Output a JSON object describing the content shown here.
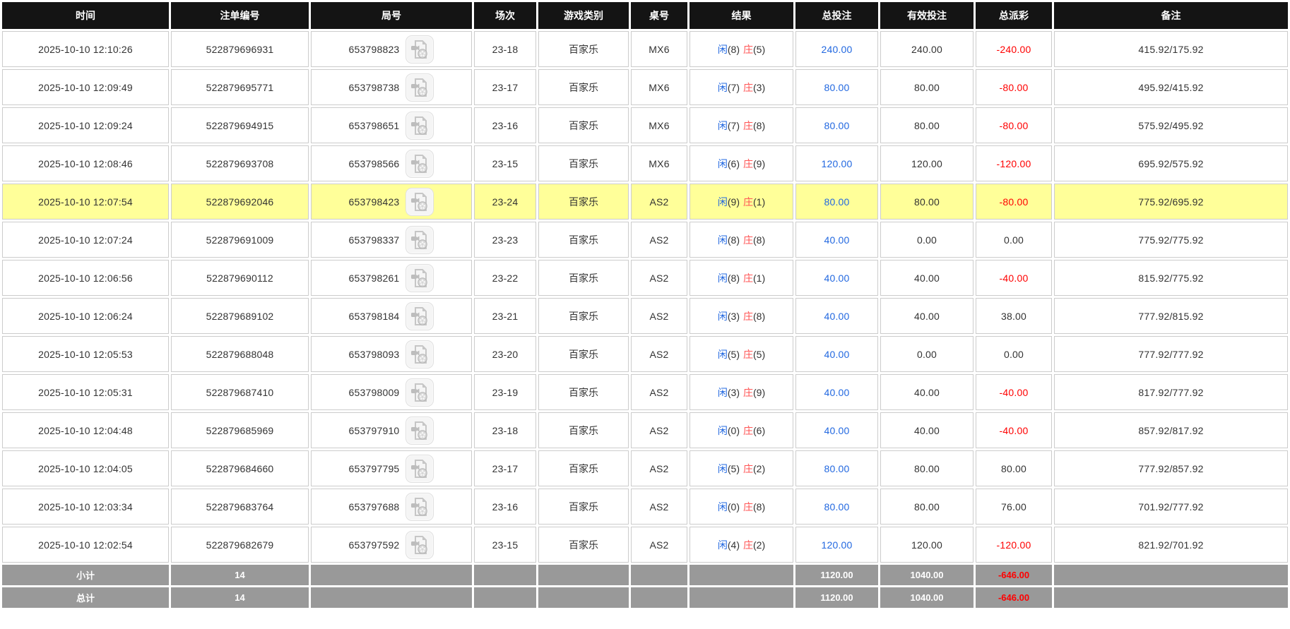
{
  "colors": {
    "header_bg": "#141414",
    "header_text": "#FFFFFF",
    "row_highlight": "#FFFF99",
    "footer_bg": "#999999",
    "footer_text": "#FFFFFF",
    "bet_blue": "#2268E0",
    "loss_red": "#FF0000",
    "banker_red": "#FF5454",
    "cell_border": "#CCCCCC",
    "body_text": "#333333"
  },
  "icons": {
    "video_button": "video-record-icon"
  },
  "table": {
    "headers": [
      "时间",
      "注单编号",
      "局号",
      "场次",
      "游戏类别",
      "桌号",
      "结果",
      "总投注",
      "有效投注",
      "总派彩",
      "备注"
    ],
    "rows": [
      {
        "time": "2025-10-10 12:10:26",
        "bet_id": "522879696931",
        "round_id": "653798823",
        "session": "23-18",
        "game": "百家乐",
        "table_id": "MX6",
        "result_player": "闲",
        "result_player_score": "(8)",
        "result_banker": "庄",
        "result_banker_score": "(5)",
        "total_bet": "240.00",
        "valid_bet": "240.00",
        "payout": "-240.00",
        "remark": "415.92/175.92",
        "highlighted": false
      },
      {
        "time": "2025-10-10 12:09:49",
        "bet_id": "522879695771",
        "round_id": "653798738",
        "session": "23-17",
        "game": "百家乐",
        "table_id": "MX6",
        "result_player": "闲",
        "result_player_score": "(7)",
        "result_banker": "庄",
        "result_banker_score": "(3)",
        "total_bet": "80.00",
        "valid_bet": "80.00",
        "payout": "-80.00",
        "remark": "495.92/415.92",
        "highlighted": false
      },
      {
        "time": "2025-10-10 12:09:24",
        "bet_id": "522879694915",
        "round_id": "653798651",
        "session": "23-16",
        "game": "百家乐",
        "table_id": "MX6",
        "result_player": "闲",
        "result_player_score": "(7)",
        "result_banker": "庄",
        "result_banker_score": "(8)",
        "total_bet": "80.00",
        "valid_bet": "80.00",
        "payout": "-80.00",
        "remark": "575.92/495.92",
        "highlighted": false
      },
      {
        "time": "2025-10-10 12:08:46",
        "bet_id": "522879693708",
        "round_id": "653798566",
        "session": "23-15",
        "game": "百家乐",
        "table_id": "MX6",
        "result_player": "闲",
        "result_player_score": "(6)",
        "result_banker": "庄",
        "result_banker_score": "(9)",
        "total_bet": "120.00",
        "valid_bet": "120.00",
        "payout": "-120.00",
        "remark": "695.92/575.92",
        "highlighted": false
      },
      {
        "time": "2025-10-10 12:07:54",
        "bet_id": "522879692046",
        "round_id": "653798423",
        "session": "23-24",
        "game": "百家乐",
        "table_id": "AS2",
        "result_player": "闲",
        "result_player_score": "(9)",
        "result_banker": "庄",
        "result_banker_score": "(1)",
        "total_bet": "80.00",
        "valid_bet": "80.00",
        "payout": "-80.00",
        "remark": "775.92/695.92",
        "highlighted": true
      },
      {
        "time": "2025-10-10 12:07:24",
        "bet_id": "522879691009",
        "round_id": "653798337",
        "session": "23-23",
        "game": "百家乐",
        "table_id": "AS2",
        "result_player": "闲",
        "result_player_score": "(8)",
        "result_banker": "庄",
        "result_banker_score": "(8)",
        "total_bet": "40.00",
        "valid_bet": "0.00",
        "payout": "0.00",
        "remark": "775.92/775.92",
        "highlighted": false
      },
      {
        "time": "2025-10-10 12:06:56",
        "bet_id": "522879690112",
        "round_id": "653798261",
        "session": "23-22",
        "game": "百家乐",
        "table_id": "AS2",
        "result_player": "闲",
        "result_player_score": "(8)",
        "result_banker": "庄",
        "result_banker_score": "(1)",
        "total_bet": "40.00",
        "valid_bet": "40.00",
        "payout": "-40.00",
        "remark": "815.92/775.92",
        "highlighted": false
      },
      {
        "time": "2025-10-10 12:06:24",
        "bet_id": "522879689102",
        "round_id": "653798184",
        "session": "23-21",
        "game": "百家乐",
        "table_id": "AS2",
        "result_player": "闲",
        "result_player_score": "(3)",
        "result_banker": "庄",
        "result_banker_score": "(8)",
        "total_bet": "40.00",
        "valid_bet": "40.00",
        "payout": "38.00",
        "remark": "777.92/815.92",
        "highlighted": false
      },
      {
        "time": "2025-10-10 12:05:53",
        "bet_id": "522879688048",
        "round_id": "653798093",
        "session": "23-20",
        "game": "百家乐",
        "table_id": "AS2",
        "result_player": "闲",
        "result_player_score": "(5)",
        "result_banker": "庄",
        "result_banker_score": "(5)",
        "total_bet": "40.00",
        "valid_bet": "0.00",
        "payout": "0.00",
        "remark": "777.92/777.92",
        "highlighted": false
      },
      {
        "time": "2025-10-10 12:05:31",
        "bet_id": "522879687410",
        "round_id": "653798009",
        "session": "23-19",
        "game": "百家乐",
        "table_id": "AS2",
        "result_player": "闲",
        "result_player_score": "(3)",
        "result_banker": "庄",
        "result_banker_score": "(9)",
        "total_bet": "40.00",
        "valid_bet": "40.00",
        "payout": "-40.00",
        "remark": "817.92/777.92",
        "highlighted": false
      },
      {
        "time": "2025-10-10 12:04:48",
        "bet_id": "522879685969",
        "round_id": "653797910",
        "session": "23-18",
        "game": "百家乐",
        "table_id": "AS2",
        "result_player": "闲",
        "result_player_score": "(0)",
        "result_banker": "庄",
        "result_banker_score": "(6)",
        "total_bet": "40.00",
        "valid_bet": "40.00",
        "payout": "-40.00",
        "remark": "857.92/817.92",
        "highlighted": false
      },
      {
        "time": "2025-10-10 12:04:05",
        "bet_id": "522879684660",
        "round_id": "653797795",
        "session": "23-17",
        "game": "百家乐",
        "table_id": "AS2",
        "result_player": "闲",
        "result_player_score": "(5)",
        "result_banker": "庄",
        "result_banker_score": "(2)",
        "total_bet": "80.00",
        "valid_bet": "80.00",
        "payout": "80.00",
        "remark": "777.92/857.92",
        "highlighted": false
      },
      {
        "time": "2025-10-10 12:03:34",
        "bet_id": "522879683764",
        "round_id": "653797688",
        "session": "23-16",
        "game": "百家乐",
        "table_id": "AS2",
        "result_player": "闲",
        "result_player_score": "(0)",
        "result_banker": "庄",
        "result_banker_score": "(8)",
        "total_bet": "80.00",
        "valid_bet": "80.00",
        "payout": "76.00",
        "remark": "701.92/777.92",
        "highlighted": false
      },
      {
        "time": "2025-10-10 12:02:54",
        "bet_id": "522879682679",
        "round_id": "653797592",
        "session": "23-15",
        "game": "百家乐",
        "table_id": "AS2",
        "result_player": "闲",
        "result_player_score": "(4)",
        "result_banker": "庄",
        "result_banker_score": "(2)",
        "total_bet": "120.00",
        "valid_bet": "120.00",
        "payout": "-120.00",
        "remark": "821.92/701.92",
        "highlighted": false
      }
    ],
    "summary": [
      {
        "label": "小计",
        "count": "14",
        "total_bet": "1120.00",
        "valid_bet": "1040.00",
        "payout": "-646.00"
      },
      {
        "label": "总计",
        "count": "14",
        "total_bet": "1120.00",
        "valid_bet": "1040.00",
        "payout": "-646.00"
      }
    ]
  }
}
